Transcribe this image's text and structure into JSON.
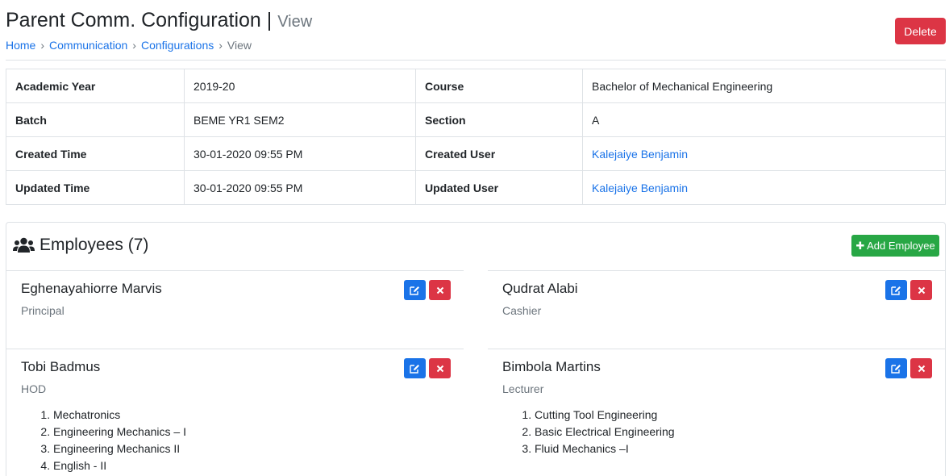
{
  "header": {
    "title": "Parent Comm. Configuration |",
    "subtitle": "View",
    "delete_label": "Delete",
    "breadcrumb": [
      "Home",
      "Communication",
      "Configurations",
      "View"
    ]
  },
  "details": {
    "rows": [
      {
        "label1": "Academic Year",
        "value1": "2019-20",
        "label2": "Course",
        "value2": "Bachelor of Mechanical Engineering"
      },
      {
        "label1": "Batch",
        "value1": "BEME YR1 SEM2",
        "label2": "Section",
        "value2": "A"
      },
      {
        "label1": "Created Time",
        "value1": "30-01-2020 09:55 PM",
        "label2": "Created User",
        "value2": "Kalejaiye Benjamin"
      },
      {
        "label1": "Updated Time",
        "value1": "30-01-2020 09:55 PM",
        "label2": "Updated User",
        "value2": "Kalejaiye Benjamin"
      }
    ]
  },
  "employees": {
    "title": "Employees (7)",
    "add_label": "Add Employee",
    "items": [
      {
        "name": "Eghenayahiorre Marvis",
        "role": "Principal",
        "subjects": []
      },
      {
        "name": "Qudrat Alabi",
        "role": "Cashier",
        "subjects": []
      },
      {
        "name": "Tobi Badmus",
        "role": "HOD",
        "subjects": [
          "Mechatronics",
          "Engineering Mechanics – I",
          "Engineering Mechanics II",
          "English - II"
        ]
      },
      {
        "name": "Bimbola Martins",
        "role": "Lecturer",
        "subjects": [
          "Cutting Tool Engineering",
          "Basic Electrical Engineering",
          "Fluid Mechanics –I"
        ]
      }
    ]
  },
  "icons": {
    "users": "users-icon",
    "plus": "plus-icon",
    "edit": "edit-icon",
    "close": "close-icon"
  },
  "colors": {
    "link": "#1a73e8",
    "danger": "#dc3545",
    "success": "#28a745",
    "primary": "#1a73e8"
  }
}
